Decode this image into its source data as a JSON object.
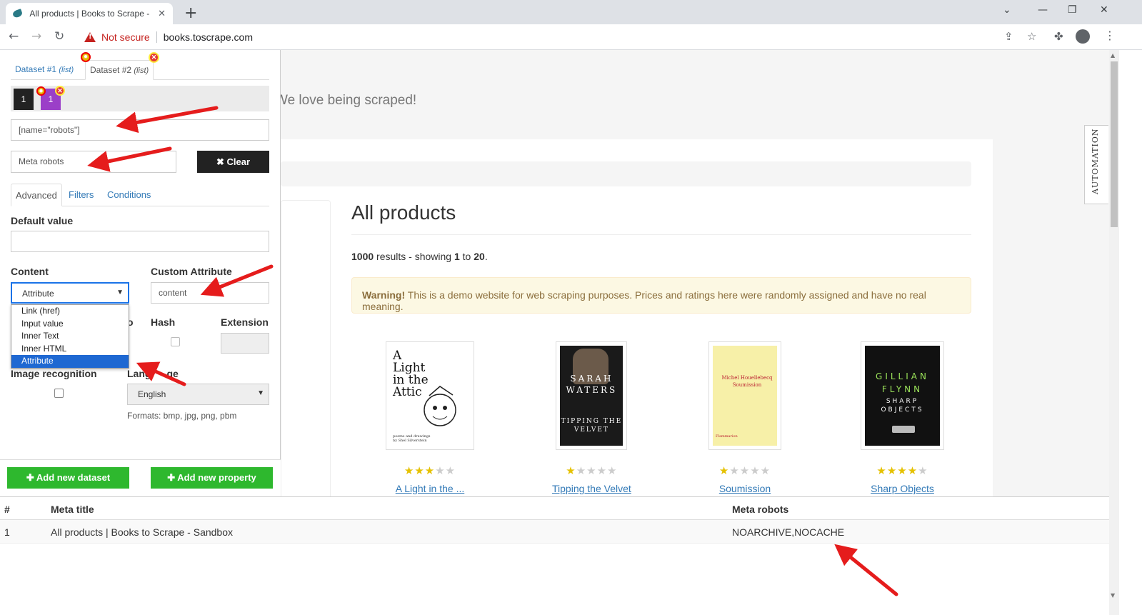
{
  "browser": {
    "tab_title": "All products | Books to Scrape - S",
    "tab_close": "✕",
    "new_tab": "+",
    "not_secure": "Not secure",
    "url": "books.toscrape.com"
  },
  "site": {
    "tagline": "We love being scraped!",
    "heading": "All products",
    "results": {
      "total": "1000",
      "mid": " results - showing ",
      "from": "1",
      "to_word": " to ",
      "to": "20",
      "end": "."
    },
    "warning_bold": "Warning!",
    "warning_text": " This is a demo website for web scraping purposes. Prices and ratings here were randomly assigned and have no real meaning.",
    "products": [
      {
        "title": "A Light in the ...",
        "rating": 3,
        "cover_text": "A Light in the Attic",
        "cover_sub": "poems and drawings by Shel Silverstein"
      },
      {
        "title": "Tipping the Velvet",
        "rating": 1,
        "cover_text": "SARAH WATERS",
        "cover_sub": "TIPPING THE VELVET"
      },
      {
        "title": "Soumission",
        "rating": 1,
        "cover_text": "Michel Houellebecq Soumission",
        "cover_sub": "Flammarion"
      },
      {
        "title": "Sharp Objects",
        "rating": 4,
        "cover_text": "GILLIAN FLYNN",
        "cover_sub": "SHARP OBJECTS"
      }
    ]
  },
  "panel": {
    "dataset_tabs": [
      {
        "label": "Dataset #1",
        "suffix": "(list)"
      },
      {
        "label": "Dataset #2",
        "suffix": "(list)"
      }
    ],
    "selector_chips": [
      "1",
      "1"
    ],
    "selector_value": "[name=\"robots\"]",
    "property_name": "Meta robots",
    "clear_label": "Clear",
    "sub_tabs": [
      "Advanced",
      "Filters",
      "Conditions"
    ],
    "default_value_label": "Default value",
    "content_label": "Content",
    "content_selected": "Attribute",
    "content_options": [
      "Link (href)",
      "Input value",
      "Inner Text",
      "Inner HTML",
      "Attribute"
    ],
    "custom_attr_label": "Custom Attribute",
    "custom_attr_value": "content",
    "hidden_label_fragment": "o",
    "hash_label": "Hash",
    "extension_label": "Extension",
    "image_recognition_label": "Image recognition",
    "language_label_a": "Lang",
    "language_label_b": "ge",
    "language_selected": "English",
    "formats": "Formats: bmp, jpg, png, pbm",
    "add_dataset_label": "Add new dataset",
    "add_property_label": "Add new property"
  },
  "table": {
    "headers": [
      "#",
      "Meta title",
      "Meta robots"
    ],
    "rows": [
      [
        "1",
        "All products | Books to Scrape - Sandbox",
        "NOARCHIVE,NOCACHE"
      ]
    ]
  },
  "side_tab": "AUTOMATION",
  "colors": {
    "arrow": "#e51c1c",
    "star": "#e5c100",
    "link": "#337ab7",
    "green": "#2eb82e",
    "dark_chip": "#222222",
    "purple_chip": "#9b3fc8"
  }
}
